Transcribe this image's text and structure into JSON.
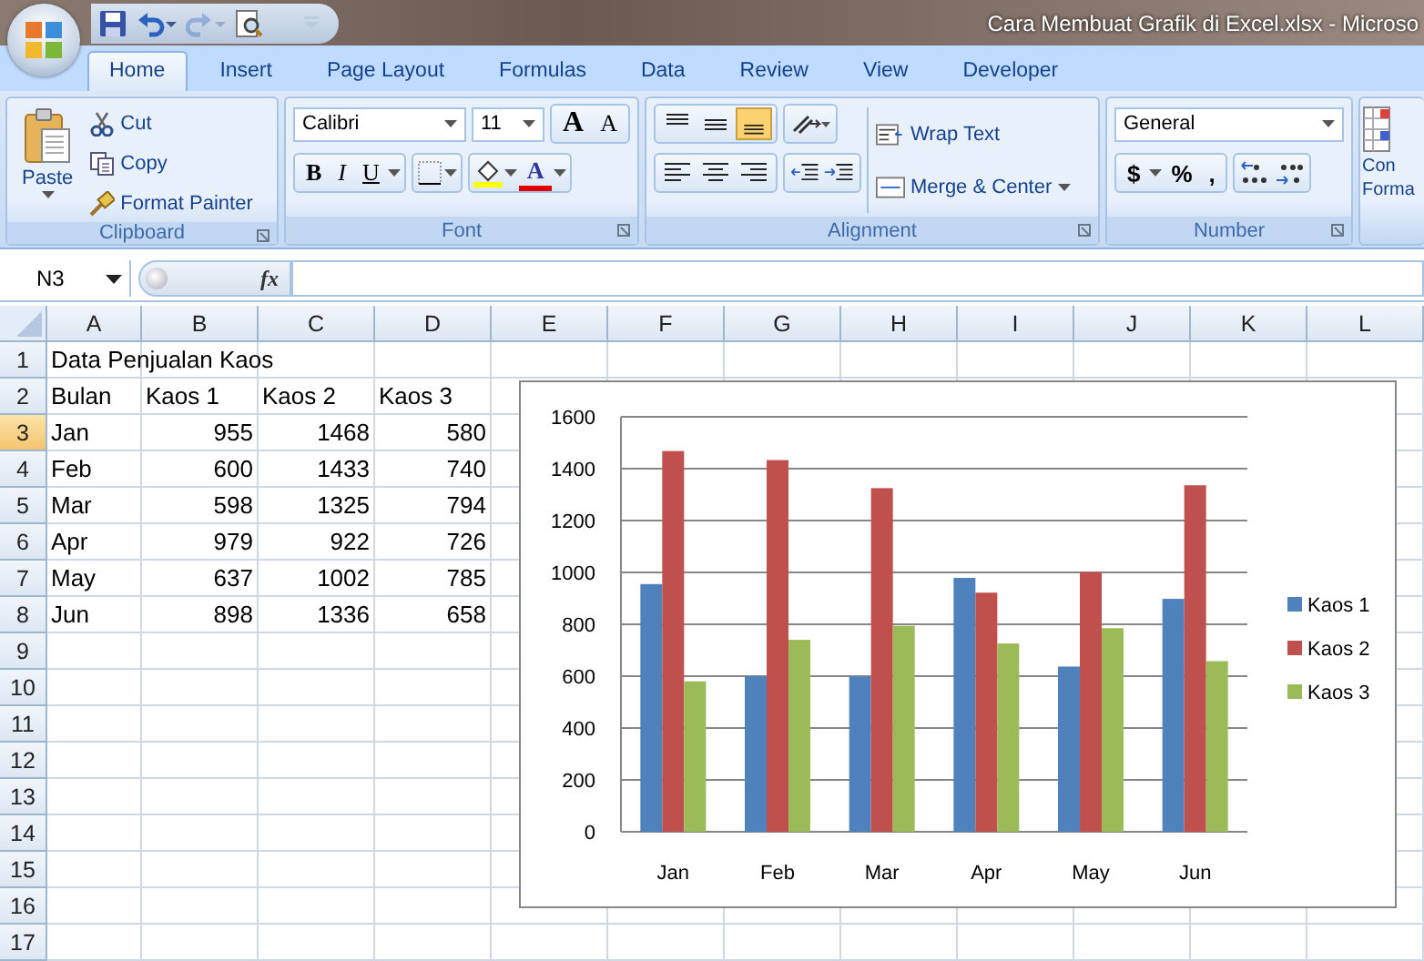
{
  "window": {
    "title": "Cara Membuat Grafik di Excel.xlsx - Microso"
  },
  "quick_access": [
    {
      "kind": "save",
      "disabled": false
    },
    {
      "kind": "undo",
      "disabled": false
    },
    {
      "kind": "redo",
      "disabled": true
    },
    {
      "kind": "preview",
      "disabled": false
    },
    {
      "kind": "customize",
      "disabled": false
    }
  ],
  "tabs": [
    {
      "label": "Home",
      "selected": true
    },
    {
      "label": "Insert",
      "selected": false
    },
    {
      "label": "Page Layout",
      "selected": false
    },
    {
      "label": "Formulas",
      "selected": false
    },
    {
      "label": "Data",
      "selected": false
    },
    {
      "label": "Review",
      "selected": false
    },
    {
      "label": "View",
      "selected": false
    },
    {
      "label": "Developer",
      "selected": false
    }
  ],
  "ribbon": {
    "clipboard": {
      "label": "Clipboard",
      "paste": "Paste",
      "items": [
        {
          "kind": "cut",
          "label": "Cut"
        },
        {
          "kind": "copy",
          "label": "Copy"
        },
        {
          "kind": "painter",
          "label": "Format Painter"
        }
      ]
    },
    "font": {
      "label": "Font",
      "font_name": "Calibri",
      "font_size": "11",
      "size_buttons": [
        {
          "kind": "grow",
          "glyph": "A"
        },
        {
          "kind": "shrink",
          "glyph": "A"
        }
      ],
      "style_buttons": [
        {
          "kind": "bold",
          "glyph": "B"
        },
        {
          "kind": "italic",
          "glyph": "I"
        },
        {
          "kind": "underline",
          "glyph": "U"
        }
      ],
      "font_color_glyph": "A"
    },
    "alignment": {
      "label": "Alignment",
      "vertical": [
        {
          "kind": "top",
          "selected": false
        },
        {
          "kind": "middle",
          "selected": false
        },
        {
          "kind": "bottom",
          "selected": true
        }
      ],
      "horizontal": [
        {
          "kind": "left",
          "selected": false
        },
        {
          "kind": "center",
          "selected": false
        },
        {
          "kind": "right",
          "selected": false
        }
      ],
      "wrap_text": "Wrap Text",
      "merge": "Merge & Center"
    },
    "number": {
      "label": "Number",
      "format": "General",
      "buttons": [
        "$",
        "%",
        ","
      ]
    },
    "styles": {
      "lines": [
        "Con",
        "Forma"
      ]
    }
  },
  "formula_bar": {
    "name_box": "N3",
    "fx": "fx"
  },
  "sheet": {
    "columns": [
      {
        "label": "A",
        "selected": false
      },
      {
        "label": "B",
        "selected": false
      },
      {
        "label": "C",
        "selected": false
      },
      {
        "label": "D",
        "selected": false
      },
      {
        "label": "E",
        "selected": false
      },
      {
        "label": "F",
        "selected": false
      },
      {
        "label": "G",
        "selected": false
      },
      {
        "label": "H",
        "selected": false
      },
      {
        "label": "I",
        "selected": false
      },
      {
        "label": "J",
        "selected": false
      },
      {
        "label": "K",
        "selected": false
      },
      {
        "label": "L",
        "selected": false
      }
    ],
    "rows": [
      {
        "header": "1",
        "selected": false,
        "cells": [
          {
            "kind": "overflow",
            "text": "Data Penjualan Kaos"
          }
        ]
      },
      {
        "header": "2",
        "selected": false,
        "cells": [
          {
            "kind": "text",
            "text": "Bulan"
          },
          {
            "kind": "text",
            "text": "Kaos 1"
          },
          {
            "kind": "text",
            "text": "Kaos 2"
          },
          {
            "kind": "text",
            "text": "Kaos 3"
          }
        ]
      },
      {
        "header": "3",
        "selected": true,
        "cells": [
          {
            "kind": "text",
            "text": "Jan"
          },
          {
            "kind": "number",
            "text": "955"
          },
          {
            "kind": "number",
            "text": "1468"
          },
          {
            "kind": "number",
            "text": "580"
          }
        ]
      },
      {
        "header": "4",
        "selected": false,
        "cells": [
          {
            "kind": "text",
            "text": "Feb"
          },
          {
            "kind": "number",
            "text": "600"
          },
          {
            "kind": "number",
            "text": "1433"
          },
          {
            "kind": "number",
            "text": "740"
          }
        ]
      },
      {
        "header": "5",
        "selected": false,
        "cells": [
          {
            "kind": "text",
            "text": "Mar"
          },
          {
            "kind": "number",
            "text": "598"
          },
          {
            "kind": "number",
            "text": "1325"
          },
          {
            "kind": "number",
            "text": "794"
          }
        ]
      },
      {
        "header": "6",
        "selected": false,
        "cells": [
          {
            "kind": "text",
            "text": "Apr"
          },
          {
            "kind": "number",
            "text": "979"
          },
          {
            "kind": "number",
            "text": "922"
          },
          {
            "kind": "number",
            "text": "726"
          }
        ]
      },
      {
        "header": "7",
        "selected": false,
        "cells": [
          {
            "kind": "text",
            "text": "May"
          },
          {
            "kind": "number",
            "text": "637"
          },
          {
            "kind": "number",
            "text": "1002"
          },
          {
            "kind": "number",
            "text": "785"
          }
        ]
      },
      {
        "header": "8",
        "selected": false,
        "cells": [
          {
            "kind": "text",
            "text": "Jun"
          },
          {
            "kind": "number",
            "text": "898"
          },
          {
            "kind": "number",
            "text": "1336"
          },
          {
            "kind": "number",
            "text": "658"
          }
        ]
      },
      {
        "header": "9",
        "selected": false,
        "cells": []
      },
      {
        "header": "10",
        "selected": false,
        "cells": []
      },
      {
        "header": "11",
        "selected": false,
        "cells": []
      },
      {
        "header": "12",
        "selected": false,
        "cells": []
      },
      {
        "header": "13",
        "selected": false,
        "cells": []
      },
      {
        "header": "14",
        "selected": false,
        "cells": []
      },
      {
        "header": "15",
        "selected": false,
        "cells": []
      },
      {
        "header": "16",
        "selected": false,
        "cells": []
      },
      {
        "header": "17",
        "selected": false,
        "cells": []
      }
    ]
  },
  "chart": {
    "chart_data": {
      "type": "bar",
      "categories": [
        "Jan",
        "Feb",
        "Mar",
        "Apr",
        "May",
        "Jun"
      ],
      "series": [
        {
          "name": "Kaos 1",
          "color": "#4f81bd",
          "values": [
            955,
            600,
            598,
            979,
            637,
            898
          ]
        },
        {
          "name": "Kaos 2",
          "color": "#c0504d",
          "values": [
            1468,
            1433,
            1325,
            922,
            1002,
            1336
          ]
        },
        {
          "name": "Kaos 3",
          "color": "#9bbb59",
          "values": [
            580,
            740,
            794,
            726,
            785,
            658
          ]
        }
      ],
      "ylim": [
        0,
        1600
      ],
      "grid": true,
      "legend": "right",
      "yticks": [
        0,
        200,
        400,
        600,
        800,
        1000,
        1200,
        1400,
        1600
      ]
    }
  }
}
